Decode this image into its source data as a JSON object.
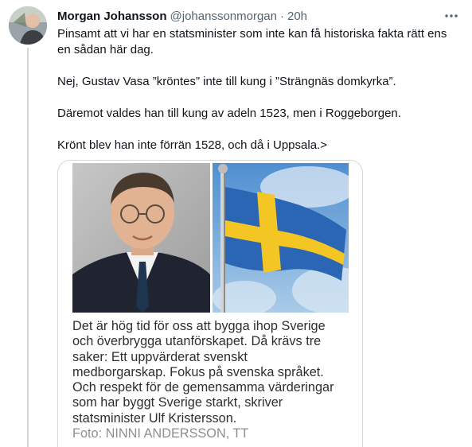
{
  "tweet": {
    "display_name": "Morgan Johansson",
    "handle": "@johanssonmorgan",
    "separator": "·",
    "time": "20h",
    "more_icon": "more-horizontal-icon",
    "paragraphs": [
      "Pinsamt att vi har en statsminister som inte kan få historiska fakta rätt ens en sådan här dag.",
      "Nej, Gustav Vasa ”kröntes” inte till kung i ”Strängnäs domkyrka”.",
      "Däremot valdes han till kung av adeln 1523, men i Roggeborgen.",
      "Krönt blev han inte förrän 1528, och då i Uppsala.>"
    ]
  },
  "media": {
    "caption_lines": [
      "Det är hög tid för oss att bygga ihop Sverige",
      "och överbrygga utanförskapet. Då krävs tre",
      "saker: Ett uppvärderat svenskt",
      "medborgarskap. Fokus på svenska språket.",
      "Och respekt för de gemensamma värderingar",
      "som har byggt Sverige starkt, skriver",
      "statsminister Ulf Kristersson."
    ],
    "credit": "Foto: NINNI ANDERSSON, TT"
  },
  "colors": {
    "text_primary": "#0f1419",
    "text_secondary": "#536471",
    "border": "#cfd9de",
    "flag_blue": "#2a66b3",
    "flag_yellow": "#f3c623"
  }
}
